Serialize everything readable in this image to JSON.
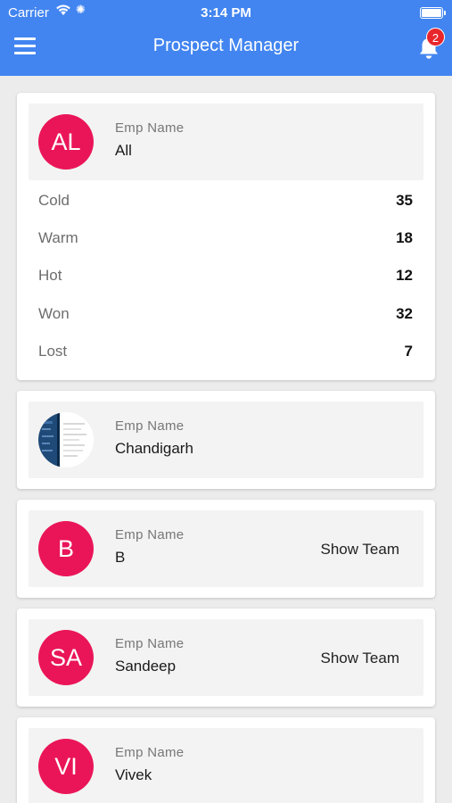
{
  "status_bar": {
    "carrier": "Carrier",
    "time": "3:14 PM"
  },
  "header": {
    "title": "Prospect Manager",
    "notification_count": "2"
  },
  "colors": {
    "header": "#4285f0",
    "avatar": "#ea1558",
    "badge": "#e8262c"
  },
  "summary_card": {
    "initials": "AL",
    "label": "Emp Name",
    "name": "All",
    "stats": [
      {
        "label": "Cold",
        "value": "35"
      },
      {
        "label": "Warm",
        "value": "18"
      },
      {
        "label": "Hot",
        "value": "12"
      },
      {
        "label": "Won",
        "value": "32"
      },
      {
        "label": "Lost",
        "value": "7"
      }
    ]
  },
  "employees": [
    {
      "photo": true,
      "label": "Emp Name",
      "name": "Chandigarh"
    },
    {
      "initials": "B",
      "label": "Emp Name",
      "name": "B",
      "action": "Show Team"
    },
    {
      "initials": "SA",
      "label": "Emp Name",
      "name": "Sandeep",
      "action": "Show Team"
    },
    {
      "initials": "VI",
      "label": "Emp Name",
      "name": "Vivek"
    }
  ]
}
